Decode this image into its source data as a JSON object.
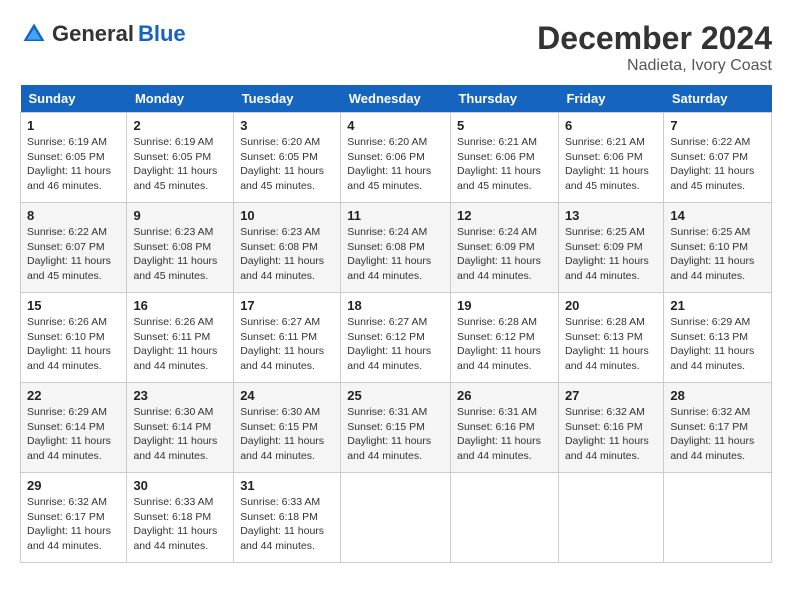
{
  "header": {
    "logo_general": "General",
    "logo_blue": "Blue",
    "month_title": "December 2024",
    "location": "Nadieta, Ivory Coast"
  },
  "days_of_week": [
    "Sunday",
    "Monday",
    "Tuesday",
    "Wednesday",
    "Thursday",
    "Friday",
    "Saturday"
  ],
  "weeks": [
    [
      {
        "day": "1",
        "sunrise": "6:19 AM",
        "sunset": "6:05 PM",
        "daylight": "11 hours and 46 minutes."
      },
      {
        "day": "2",
        "sunrise": "6:19 AM",
        "sunset": "6:05 PM",
        "daylight": "11 hours and 45 minutes."
      },
      {
        "day": "3",
        "sunrise": "6:20 AM",
        "sunset": "6:05 PM",
        "daylight": "11 hours and 45 minutes."
      },
      {
        "day": "4",
        "sunrise": "6:20 AM",
        "sunset": "6:06 PM",
        "daylight": "11 hours and 45 minutes."
      },
      {
        "day": "5",
        "sunrise": "6:21 AM",
        "sunset": "6:06 PM",
        "daylight": "11 hours and 45 minutes."
      },
      {
        "day": "6",
        "sunrise": "6:21 AM",
        "sunset": "6:06 PM",
        "daylight": "11 hours and 45 minutes."
      },
      {
        "day": "7",
        "sunrise": "6:22 AM",
        "sunset": "6:07 PM",
        "daylight": "11 hours and 45 minutes."
      }
    ],
    [
      {
        "day": "8",
        "sunrise": "6:22 AM",
        "sunset": "6:07 PM",
        "daylight": "11 hours and 45 minutes."
      },
      {
        "day": "9",
        "sunrise": "6:23 AM",
        "sunset": "6:08 PM",
        "daylight": "11 hours and 45 minutes."
      },
      {
        "day": "10",
        "sunrise": "6:23 AM",
        "sunset": "6:08 PM",
        "daylight": "11 hours and 44 minutes."
      },
      {
        "day": "11",
        "sunrise": "6:24 AM",
        "sunset": "6:08 PM",
        "daylight": "11 hours and 44 minutes."
      },
      {
        "day": "12",
        "sunrise": "6:24 AM",
        "sunset": "6:09 PM",
        "daylight": "11 hours and 44 minutes."
      },
      {
        "day": "13",
        "sunrise": "6:25 AM",
        "sunset": "6:09 PM",
        "daylight": "11 hours and 44 minutes."
      },
      {
        "day": "14",
        "sunrise": "6:25 AM",
        "sunset": "6:10 PM",
        "daylight": "11 hours and 44 minutes."
      }
    ],
    [
      {
        "day": "15",
        "sunrise": "6:26 AM",
        "sunset": "6:10 PM",
        "daylight": "11 hours and 44 minutes."
      },
      {
        "day": "16",
        "sunrise": "6:26 AM",
        "sunset": "6:11 PM",
        "daylight": "11 hours and 44 minutes."
      },
      {
        "day": "17",
        "sunrise": "6:27 AM",
        "sunset": "6:11 PM",
        "daylight": "11 hours and 44 minutes."
      },
      {
        "day": "18",
        "sunrise": "6:27 AM",
        "sunset": "6:12 PM",
        "daylight": "11 hours and 44 minutes."
      },
      {
        "day": "19",
        "sunrise": "6:28 AM",
        "sunset": "6:12 PM",
        "daylight": "11 hours and 44 minutes."
      },
      {
        "day": "20",
        "sunrise": "6:28 AM",
        "sunset": "6:13 PM",
        "daylight": "11 hours and 44 minutes."
      },
      {
        "day": "21",
        "sunrise": "6:29 AM",
        "sunset": "6:13 PM",
        "daylight": "11 hours and 44 minutes."
      }
    ],
    [
      {
        "day": "22",
        "sunrise": "6:29 AM",
        "sunset": "6:14 PM",
        "daylight": "11 hours and 44 minutes."
      },
      {
        "day": "23",
        "sunrise": "6:30 AM",
        "sunset": "6:14 PM",
        "daylight": "11 hours and 44 minutes."
      },
      {
        "day": "24",
        "sunrise": "6:30 AM",
        "sunset": "6:15 PM",
        "daylight": "11 hours and 44 minutes."
      },
      {
        "day": "25",
        "sunrise": "6:31 AM",
        "sunset": "6:15 PM",
        "daylight": "11 hours and 44 minutes."
      },
      {
        "day": "26",
        "sunrise": "6:31 AM",
        "sunset": "6:16 PM",
        "daylight": "11 hours and 44 minutes."
      },
      {
        "day": "27",
        "sunrise": "6:32 AM",
        "sunset": "6:16 PM",
        "daylight": "11 hours and 44 minutes."
      },
      {
        "day": "28",
        "sunrise": "6:32 AM",
        "sunset": "6:17 PM",
        "daylight": "11 hours and 44 minutes."
      }
    ],
    [
      {
        "day": "29",
        "sunrise": "6:32 AM",
        "sunset": "6:17 PM",
        "daylight": "11 hours and 44 minutes."
      },
      {
        "day": "30",
        "sunrise": "6:33 AM",
        "sunset": "6:18 PM",
        "daylight": "11 hours and 44 minutes."
      },
      {
        "day": "31",
        "sunrise": "6:33 AM",
        "sunset": "6:18 PM",
        "daylight": "11 hours and 44 minutes."
      },
      null,
      null,
      null,
      null
    ]
  ]
}
